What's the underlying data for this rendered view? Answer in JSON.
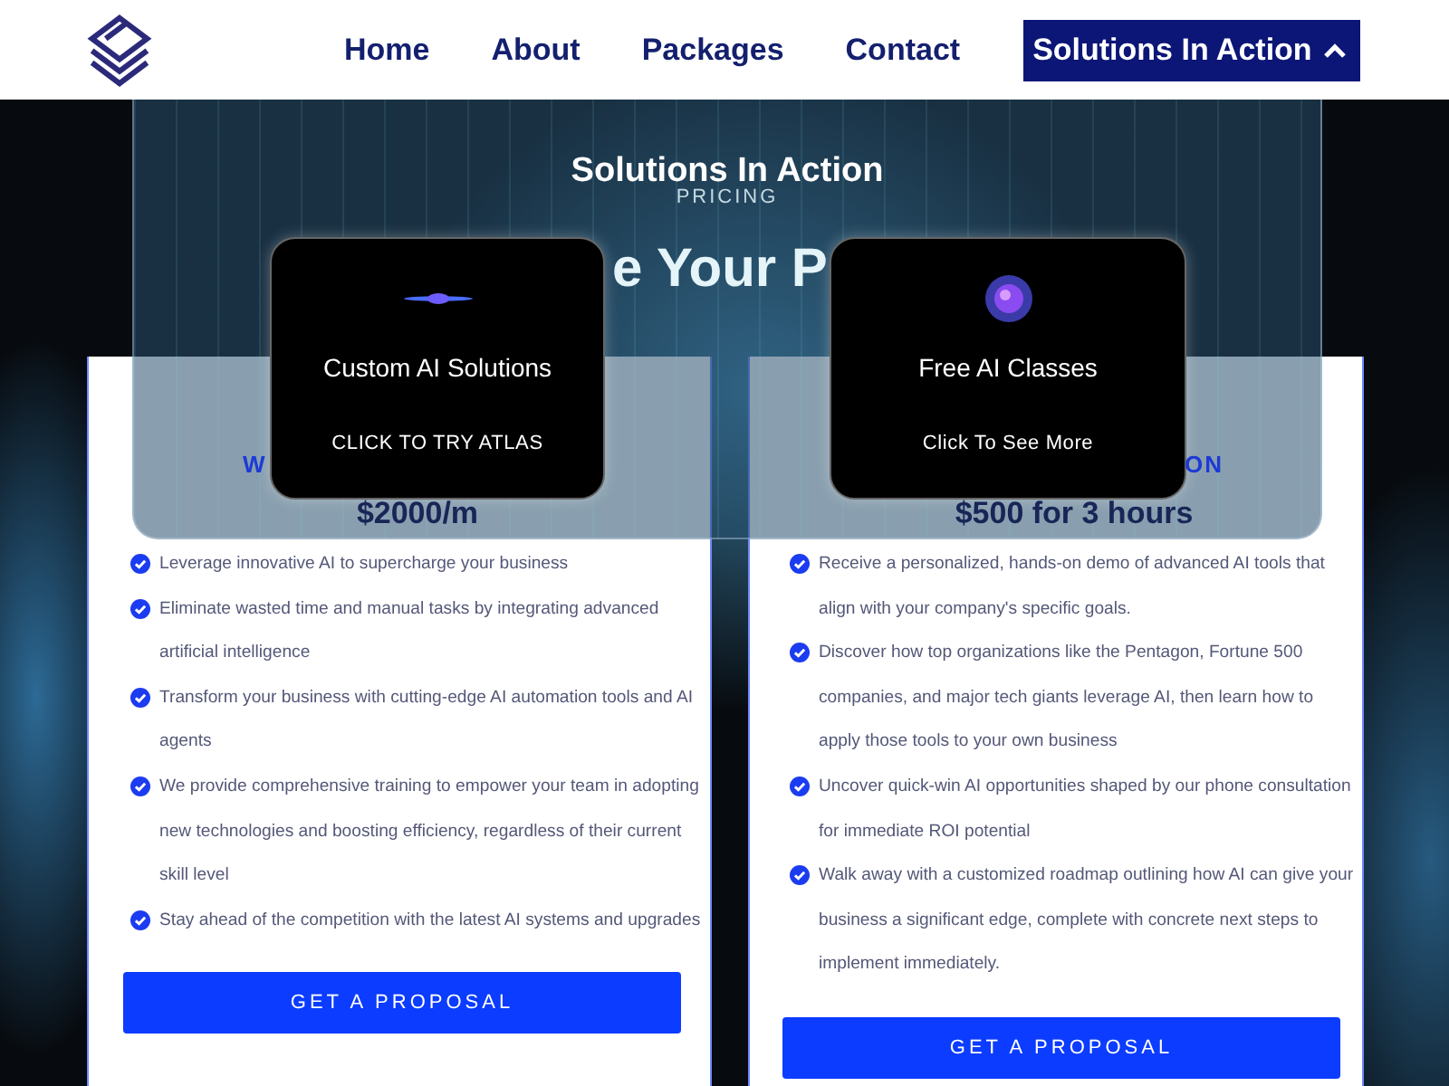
{
  "nav": {
    "items": [
      {
        "label": "Home",
        "selected": false,
        "dropdown": false
      },
      {
        "label": "About",
        "selected": false,
        "dropdown": false
      },
      {
        "label": "Packages",
        "selected": false,
        "dropdown": false
      },
      {
        "label": "Contact",
        "selected": false,
        "dropdown": false
      },
      {
        "label": "Solutions In Action",
        "selected": true,
        "dropdown": true
      }
    ]
  },
  "hero": {
    "heading": "e Your P"
  },
  "plans": [
    {
      "subtitle": "W",
      "price": "$2000/m",
      "features": [
        "Leverage innovative AI to supercharge your business",
        "Eliminate wasted time and manual tasks by integrating advanced artificial intelligence",
        "Transform your business with cutting-edge AI automation tools and AI agents",
        "We provide comprehensive training to empower your team in adopting new technologies and boosting efficiency, regardless of their current skill level",
        "Stay ahead of the competition with the latest AI systems and upgrades"
      ],
      "button": "GET A PROPOSAL"
    },
    {
      "subtitle": "ON",
      "price": "$500 for 3 hours",
      "features": [
        "Receive a personalized, hands-on demo of advanced AI tools that align with your company's specific goals.",
        "Discover how top organizations like the Pentagon, Fortune 500 companies, and major tech giants leverage AI, then learn how to apply those tools to your own business",
        "Uncover quick-win AI opportunities shaped by our phone consultation for immediate ROI potential",
        "Walk away with a customized roadmap outlining how AI can give your business a significant edge, complete with concrete next steps to implement immediately."
      ],
      "button": "GET A PROPOSAL"
    }
  ],
  "dropdown_menu": {
    "title": "Solutions In Action",
    "subtitle": "PRICING",
    "cards": [
      {
        "kind": "glow-line",
        "title": "Custom AI Solutions",
        "link": "CLICK TO TRY ATLAS"
      },
      {
        "kind": "orb",
        "title": "Free AI Classes",
        "link": "Click To See More"
      }
    ]
  }
}
